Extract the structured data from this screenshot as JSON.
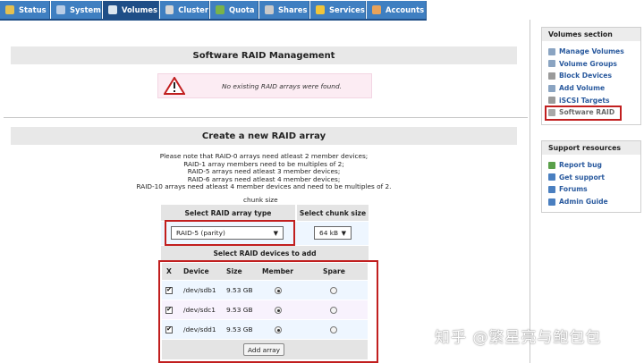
{
  "nav": {
    "tabs": [
      {
        "label": "Status",
        "icon": "status-icon",
        "color": "#e4c050"
      },
      {
        "label": "System",
        "icon": "system-icon",
        "color": "#b9cde6"
      },
      {
        "label": "Volumes",
        "icon": "volumes-icon",
        "color": "#dce6f0"
      },
      {
        "label": "Cluster",
        "icon": "cluster-icon",
        "color": "#d6d6d6"
      },
      {
        "label": "Quota",
        "icon": "quota-icon",
        "color": "#79b34a"
      },
      {
        "label": "Shares",
        "icon": "shares-icon",
        "color": "#c9c9c9"
      },
      {
        "label": "Services",
        "icon": "services-icon",
        "color": "#f0c53a"
      },
      {
        "label": "Accounts",
        "icon": "accounts-icon",
        "color": "#e7a25a"
      }
    ],
    "active_tab": "Volumes"
  },
  "raid_management": {
    "title": "Software RAID Management",
    "alert_message": "No existing RAID arrays were found."
  },
  "create_array": {
    "title": "Create a new RAID array",
    "notes": [
      "Please note that RAID-0 arrays need atleast 2 member devices;",
      "RAID-1 array members need to be multiples of 2;",
      "RAID-5 arrays need atleast 3 member devices;",
      "RAID-6 arrays need atleast 4 member devices;",
      "RAID-10 arrays need atleast 4 member devices and need to be multiples of 2."
    ],
    "chunk_size_label": "chunk size",
    "select_type_header": "Select RAID array type",
    "select_chunk_header": "Select chunk size",
    "raid_type_value": "RAID-5 (parity)",
    "chunk_size_value": "64 kB",
    "devices_header": "Select RAID devices to add",
    "columns": [
      "X",
      "Device",
      "Size",
      "Member",
      "Spare"
    ],
    "devices": [
      {
        "device": "/dev/sdb1",
        "size": "9.53 GB",
        "checked": true,
        "role": "member"
      },
      {
        "device": "/dev/sdc1",
        "size": "9.53 GB",
        "checked": true,
        "role": "member"
      },
      {
        "device": "/dev/sdd1",
        "size": "9.53 GB",
        "checked": true,
        "role": "member"
      }
    ],
    "add_button": "Add array"
  },
  "sidebar": {
    "volumes_section": {
      "title": "Volumes section",
      "items": [
        {
          "label": "Manage Volumes",
          "icon": "manage-volumes-icon"
        },
        {
          "label": "Volume Groups",
          "icon": "volume-groups-icon"
        },
        {
          "label": "Block Devices",
          "icon": "block-devices-icon"
        },
        {
          "label": "Add Volume",
          "icon": "add-volume-icon"
        },
        {
          "label": "iSCSI Targets",
          "icon": "iscsi-targets-icon"
        },
        {
          "label": "Software RAID",
          "icon": "software-raid-icon"
        }
      ]
    },
    "support": {
      "title": "Support resources",
      "items": [
        {
          "label": "Report bug",
          "icon": "report-bug-icon"
        },
        {
          "label": "Get support",
          "icon": "get-support-icon"
        },
        {
          "label": "Forums",
          "icon": "forums-icon"
        },
        {
          "label": "Admin Guide",
          "icon": "admin-guide-icon"
        }
      ]
    }
  },
  "watermark": "知乎 @繁星亮与鲍包包",
  "colors": {
    "nav_blue": "#3f7fc1",
    "nav_active": "#1f4e87",
    "link_blue": "#2a5a9e",
    "highlight_red": "#c11f1f",
    "alert_bg": "#fcecf3"
  }
}
